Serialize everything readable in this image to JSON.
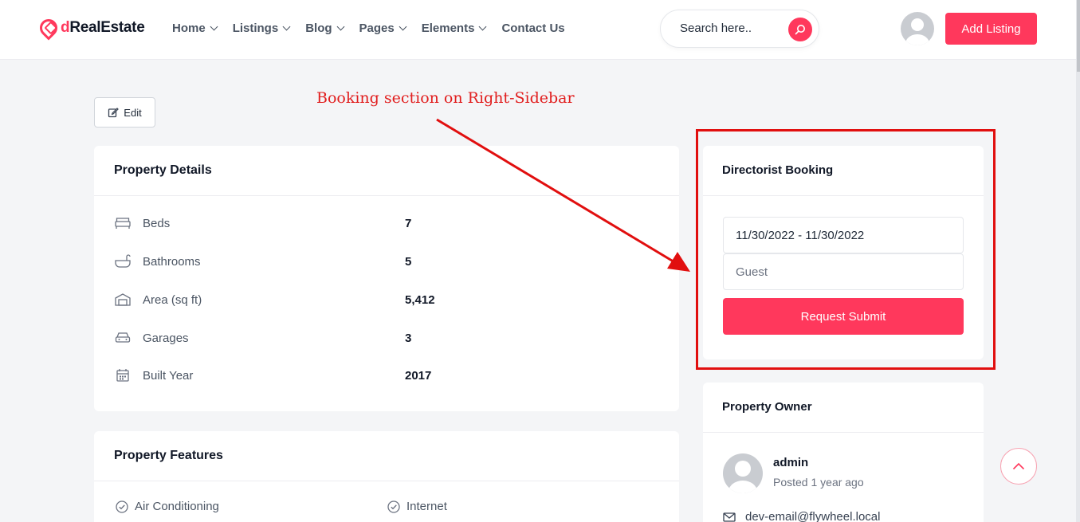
{
  "brand": {
    "prefix": "d",
    "name": "RealEstate"
  },
  "nav": [
    {
      "label": "Home",
      "has_menu": true
    },
    {
      "label": "Listings",
      "has_menu": true
    },
    {
      "label": "Blog",
      "has_menu": true
    },
    {
      "label": "Pages",
      "has_menu": true
    },
    {
      "label": "Elements",
      "has_menu": true
    },
    {
      "label": "Contact Us",
      "has_menu": false
    }
  ],
  "search": {
    "placeholder": "Search here.."
  },
  "header": {
    "add_listing_label": "Add Listing"
  },
  "annotation": {
    "text": "Booking section on Right-Sidebar"
  },
  "edit": {
    "label": "Edit"
  },
  "property_details": {
    "title": "Property Details",
    "rows": [
      {
        "icon": "bed-icon",
        "label": "Beds",
        "value": "7"
      },
      {
        "icon": "bathtub-icon",
        "label": "Bathrooms",
        "value": "5"
      },
      {
        "icon": "area-icon",
        "label": "Area (sq ft)",
        "value": "5,412"
      },
      {
        "icon": "car-icon",
        "label": "Garages",
        "value": "3"
      },
      {
        "icon": "calendar-icon",
        "label": "Built Year",
        "value": "2017"
      }
    ]
  },
  "property_features": {
    "title": "Property Features",
    "items": [
      "Air Conditioning",
      "Internet"
    ]
  },
  "booking": {
    "title": "Directorist Booking",
    "date_range": "11/30/2022 - 11/30/2022",
    "guest_placeholder": "Guest",
    "submit_label": "Request Submit"
  },
  "owner": {
    "title": "Property Owner",
    "name": "admin",
    "posted": "Posted 1 year ago",
    "email": "dev-email@flywheel.local"
  },
  "colors": {
    "accent": "#ff385c",
    "annotation": "#e10f0f",
    "background": "#f4f5f7"
  }
}
